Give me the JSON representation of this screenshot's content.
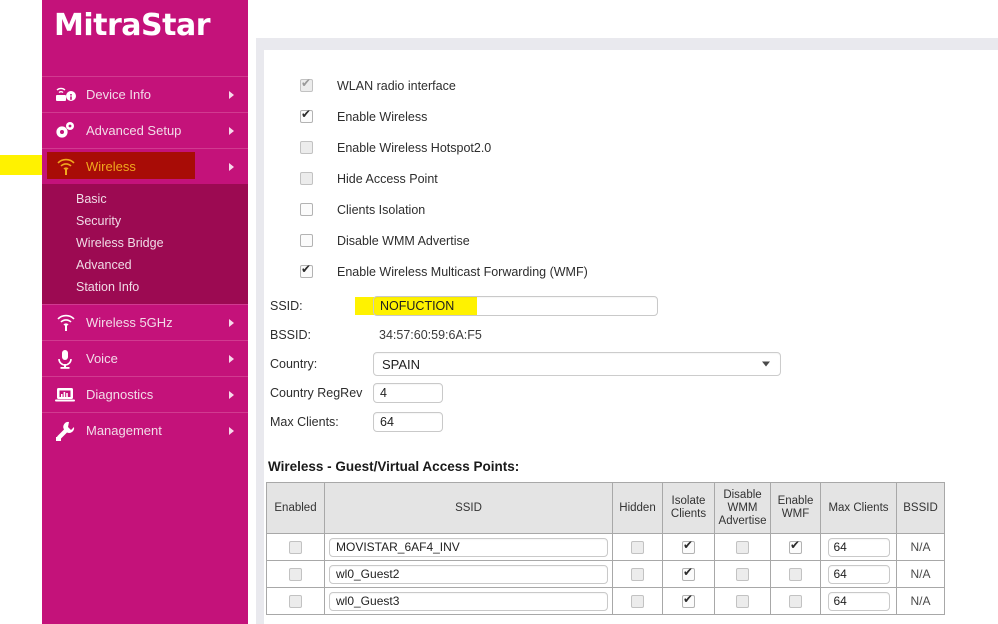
{
  "brand": {
    "logo_text": "MitraStar"
  },
  "sidebar": {
    "items": [
      {
        "label": "Device Info",
        "icon": "device-info-icon",
        "has_arrow": true,
        "selected": false
      },
      {
        "label": "Advanced Setup",
        "icon": "gears-icon",
        "has_arrow": true,
        "selected": false
      },
      {
        "label": "Wireless",
        "icon": "wifi-icon",
        "has_arrow": true,
        "selected": true
      },
      {
        "label": "Wireless 5GHz",
        "icon": "wifi-icon",
        "has_arrow": true,
        "selected": false
      },
      {
        "label": "Voice",
        "icon": "microphone-icon",
        "has_arrow": true,
        "selected": false
      },
      {
        "label": "Diagnostics",
        "icon": "diagnostics-icon",
        "has_arrow": true,
        "selected": false
      },
      {
        "label": "Management",
        "icon": "wrench-icon",
        "has_arrow": true,
        "selected": false
      }
    ],
    "submenu": [
      {
        "label": "Basic"
      },
      {
        "label": "Security"
      },
      {
        "label": "Wireless Bridge"
      },
      {
        "label": "Advanced"
      },
      {
        "label": "Station Info"
      }
    ]
  },
  "main": {
    "checkboxes": [
      {
        "label": "WLAN radio interface",
        "checked": true,
        "disabled": true
      },
      {
        "label": "Enable Wireless",
        "checked": true,
        "disabled": false
      },
      {
        "label": "Enable Wireless Hotspot2.0",
        "checked": false,
        "disabled": true
      },
      {
        "label": "Hide Access Point",
        "checked": false,
        "disabled": true
      },
      {
        "label": "Clients Isolation",
        "checked": false,
        "disabled": false
      },
      {
        "label": "Disable WMM Advertise",
        "checked": false,
        "disabled": false
      },
      {
        "label": "Enable Wireless Multicast Forwarding (WMF)",
        "checked": true,
        "disabled": false
      }
    ],
    "fields": {
      "ssid_label": "SSID:",
      "ssid_value": "NOFUCTION",
      "bssid_label": "BSSID:",
      "bssid_value": "34:57:60:59:6A:F5",
      "country_label": "Country:",
      "country_value": "SPAIN",
      "regrev_label": "Country RegRev",
      "regrev_value": "4",
      "maxclients_label": "Max Clients:",
      "maxclients_value": "64"
    },
    "guest_section": {
      "title": "Wireless - Guest/Virtual Access Points:",
      "headers": [
        "Enabled",
        "SSID",
        "Hidden",
        "Isolate Clients",
        "Disable WMM Advertise",
        "Enable WMF",
        "Max Clients",
        "BSSID"
      ],
      "rows": [
        {
          "enabled": false,
          "ssid": "MOVISTAR_6AF4_INV",
          "hidden": false,
          "isolate_clients": true,
          "disable_wmm": false,
          "enable_wmf": true,
          "max_clients": "64",
          "bssid": "N/A"
        },
        {
          "enabled": false,
          "ssid": "wl0_Guest2",
          "hidden": false,
          "isolate_clients": true,
          "disable_wmm": false,
          "enable_wmf": false,
          "max_clients": "64",
          "bssid": "N/A"
        },
        {
          "enabled": false,
          "ssid": "wl0_Guest3",
          "hidden": false,
          "isolate_clients": true,
          "disable_wmm": false,
          "enable_wmf": false,
          "max_clients": "64",
          "bssid": "N/A"
        }
      ]
    }
  },
  "annotations": {
    "highlight_color": "#fff200",
    "selected_nav_bg": "#a80c06",
    "selected_nav_text": "#f0a81e",
    "brand_color": "#c4127a"
  }
}
